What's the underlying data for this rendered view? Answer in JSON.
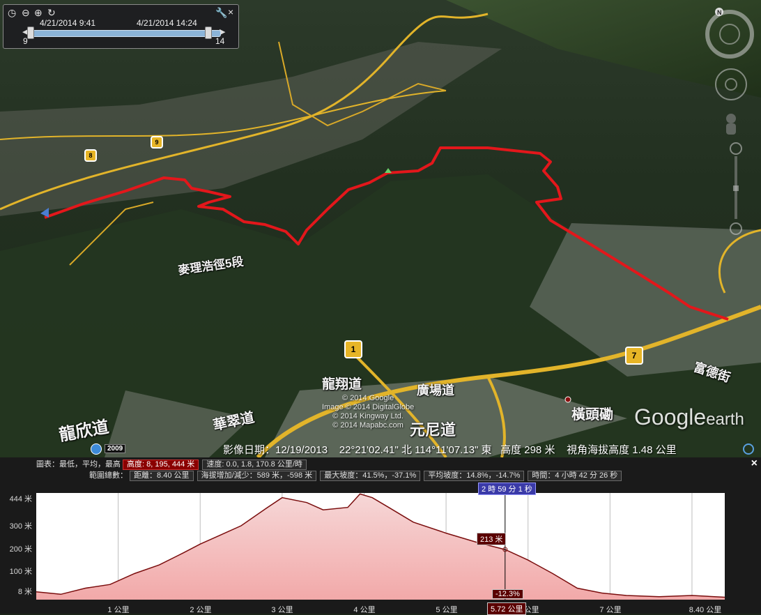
{
  "time_control": {
    "start_datetime": "4/21/2014    9:41",
    "end_datetime": "4/21/2014   14:24",
    "start_num": "9",
    "end_num": "14"
  },
  "map_labels": {
    "trail": "麥理浩徑5段",
    "road_lungcheung": "龍翔道",
    "road_lungyan": "龍欣道",
    "road_other1": "華翠道",
    "road_other2": "廣場道",
    "road_other3": "元尼道",
    "area_hengtauhom": "橫頭磡",
    "road_right": "富德街"
  },
  "route_badges": [
    "1",
    "7",
    "8",
    "9"
  ],
  "pegman_year": "2009",
  "copyright_lines": [
    "© 2014 Google",
    "Image © 2014 DigitalGlobe",
    "© 2014 Kingway Ltd.",
    "© 2014 Mapabc.com"
  ],
  "brand": {
    "main": "Google",
    "sub": "earth"
  },
  "status": {
    "imagery_date": "影像日期：12/19/2013",
    "coords": "22°21'02.41\" 北 114°11'07.13\" 東",
    "elevation": "高度   298 米",
    "eye_alt": "視角海拔高度   1.48 公里"
  },
  "profile": {
    "legend_label": "圖表：最低，平均，最高",
    "altitude_cell": "高度: 8, 195, 444 米",
    "speed_cell": "速度: 0.0, 1.8, 170.8 公里/時",
    "summary_label": "範圍總數：",
    "distance_cell": "距離：8.40 公里",
    "gain_cell": "海拔增加/減少：589 米，-598 米",
    "max_slope_cell": "最大坡度：41.5%，-37.1%",
    "avg_slope_cell": "平均坡度：14.8%，-14.7%",
    "time_cell": "時間：4 小時 42 分 26 秒",
    "close_label": "×",
    "y_ticks": [
      "444 米",
      "300 米",
      "200 米",
      "100 米",
      "8 米"
    ],
    "x_ticks": [
      "1 公里",
      "2 公里",
      "3 公里",
      "4 公里",
      "5 公里",
      "6 公里",
      "7 公里",
      "8.40 公里"
    ],
    "cursor_time": "2 時 59 分 1 秒",
    "cursor_alt": "213 米",
    "cursor_slope": "-12.3%",
    "cursor_dist": "5.72 公里"
  },
  "chart_data": {
    "type": "area",
    "xlabel": "",
    "ylabel": "",
    "xlim": [
      0,
      8.4
    ],
    "ylim": [
      8,
      444
    ],
    "x": [
      0,
      0.3,
      0.6,
      0.9,
      1.2,
      1.5,
      1.8,
      2.0,
      2.2,
      2.5,
      2.8,
      3.0,
      3.3,
      3.5,
      3.8,
      3.95,
      4.1,
      4.3,
      4.6,
      5.0,
      5.4,
      5.72,
      6.0,
      6.3,
      6.6,
      6.9,
      7.2,
      7.6,
      8.0,
      8.4
    ],
    "series": [
      {
        "values": [
          40,
          30,
          55,
          70,
          115,
          150,
          200,
          235,
          265,
          310,
          380,
          425,
          405,
          375,
          385,
          440,
          425,
          385,
          325,
          280,
          240,
          213,
          170,
          115,
          55,
          35,
          25,
          20,
          25,
          18
        ]
      }
    ],
    "grid": true
  }
}
